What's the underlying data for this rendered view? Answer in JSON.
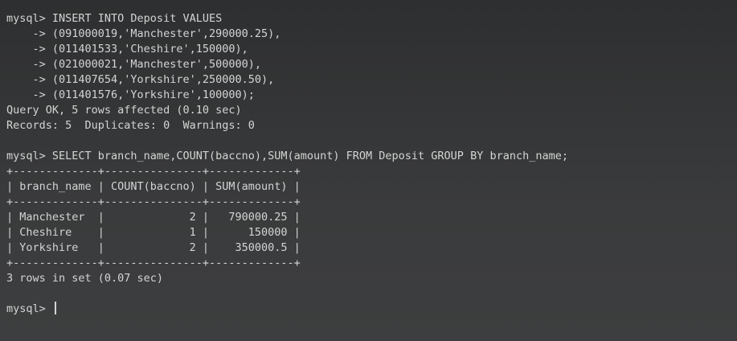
{
  "terminal": {
    "lines": [
      "mysql> INSERT INTO Deposit VALUES",
      "    -> (091000019,'Manchester',290000.25),",
      "    -> (011401533,'Cheshire',150000),",
      "    -> (021000021,'Manchester',500000),",
      "    -> (011407654,'Yorkshire',250000.50),",
      "    -> (011401576,'Yorkshire',100000);",
      "Query OK, 5 rows affected (0.10 sec)",
      "Records: 5  Duplicates: 0  Warnings: 0",
      "",
      "mysql> SELECT branch_name,COUNT(baccno),SUM(amount) FROM Deposit GROUP BY branch_name;",
      "+-------------+---------------+-------------+",
      "| branch_name | COUNT(baccno) | SUM(amount) |",
      "+-------------+---------------+-------------+",
      "| Manchester  |             2 |   790000.25 |",
      "| Cheshire    |             1 |      150000 |",
      "| Yorkshire   |             2 |    350000.5 |",
      "+-------------+---------------+-------------+",
      "3 rows in set (0.07 sec)",
      ""
    ],
    "prompt": "mysql> "
  }
}
